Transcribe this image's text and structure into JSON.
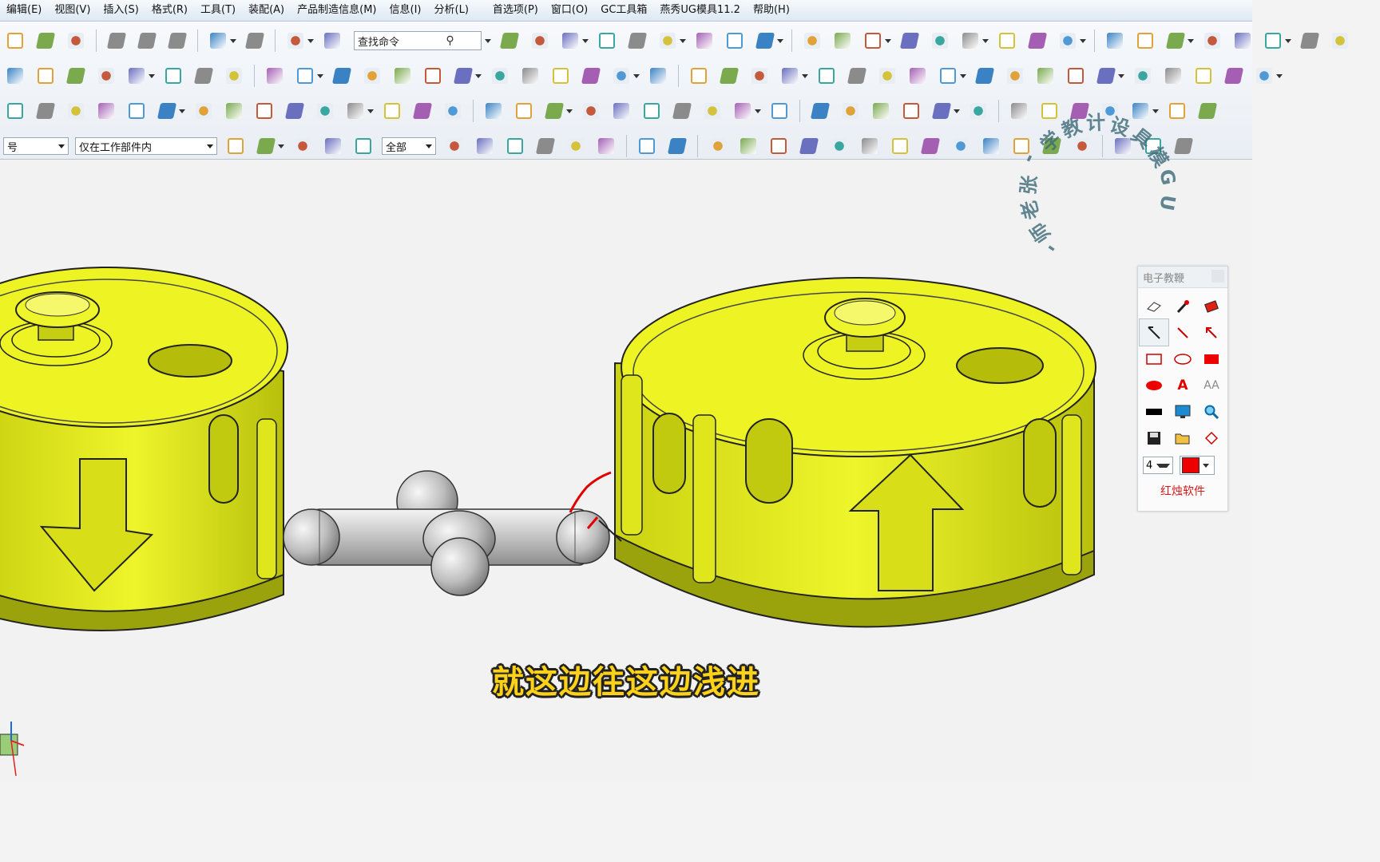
{
  "menu": {
    "items": [
      "编辑(E)",
      "视图(V)",
      "插入(S)",
      "格式(R)",
      "工具(T)",
      "装配(A)",
      "产品制造信息(M)",
      "信息(I)",
      "分析(L)"
    ],
    "items_right": [
      "首选项(P)",
      "窗口(O)",
      "GC工具箱",
      "燕秀UG模具11.2",
      "帮助(H)"
    ]
  },
  "toolbar": {
    "search_text": "查找命令"
  },
  "selection_bar": {
    "type_filter": "号",
    "scope": "仅在工作部件内",
    "filter_all": "全部"
  },
  "caption": "就这边往这边浅进",
  "watermark": [
    "U",
    "G",
    "模",
    "具",
    "设",
    "计",
    "教",
    "学",
    "-",
    "张",
    "老",
    "师",
    "-"
  ],
  "annotation_panel": {
    "title": "电子教鞭",
    "line_width": "4",
    "text_size_label": "AA",
    "text_label": "A",
    "brand": "红烛软件",
    "pen_color": "#ee0000"
  },
  "colors": {
    "part_yellow": "#e8f01a",
    "part_dark": "#7f8a0a",
    "pin_gray": "#c9c9c9"
  }
}
